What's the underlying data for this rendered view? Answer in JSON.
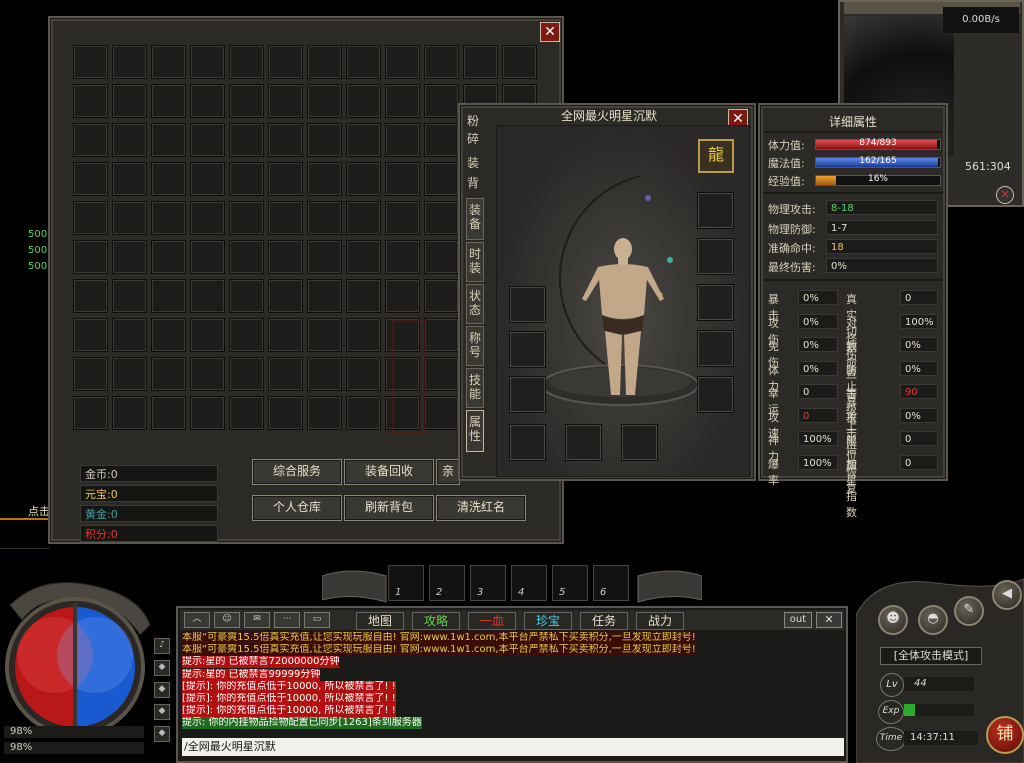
{
  "minimap": {
    "speed": "0.00B/s",
    "coords": "561:304"
  },
  "left_numbers": [
    "500",
    "500",
    "500"
  ],
  "left_partial": "点击",
  "bag": {
    "currency": [
      {
        "label": "金币",
        "value": "0",
        "color": "#e8e0c8"
      },
      {
        "label": "元宝",
        "value": "0",
        "color": "#e6c84a"
      },
      {
        "label": "黄金",
        "value": "0",
        "color": "#3fa0a8"
      },
      {
        "label": "积分",
        "value": "0",
        "color": "#e03a2a"
      }
    ],
    "buttons_row1": [
      "综合服务",
      "装备回收",
      "亲"
    ],
    "buttons_row2": [
      "个人仓库",
      "刷新背包",
      "清洗红名"
    ]
  },
  "character": {
    "title": "全网最火明星沉默",
    "side_tabs_top": [
      "粉",
      "碎",
      "装",
      "背"
    ],
    "tabs": [
      "装备",
      "时装",
      "状态",
      "称号",
      "技能",
      "属性"
    ],
    "emblem": "龍"
  },
  "details": {
    "title": "详细属性",
    "hp_label": "体力值:",
    "hp_text": "874/893",
    "hp_fraction": 0.979,
    "mp_label": "魔法值:",
    "mp_text": "162/165",
    "mp_fraction": 0.982,
    "exp_label": "经验值:",
    "exp_text": "16%",
    "exp_fraction": 0.16,
    "main_stats": [
      {
        "label": "物理攻击:",
        "value": "8-18",
        "color": "#57d957"
      },
      {
        "label": "物理防御:",
        "value": "1-7",
        "color": "#e8e0c8"
      },
      {
        "label": "准确命中:",
        "value": "18",
        "color": "#e6c84a"
      },
      {
        "label": "最终伤害:",
        "value": "0%",
        "color": "#e8e0c8"
      }
    ],
    "grid_stats": [
      {
        "l1": "暴击",
        "v1": "0%",
        "c1": "#e8e0c8",
        "l2": "真实切割",
        "v2": "0",
        "c2": "#e8e0c8"
      },
      {
        "l1": "攻伤",
        "v1": "0%",
        "c1": "#e8e0c8",
        "l2": "对怪伤害",
        "v2": "100%",
        "c2": "#e8e0c8"
      },
      {
        "l1": "免伤",
        "v1": "0%",
        "c1": "#e8e0c8",
        "l2": "致命一击",
        "v2": "0%",
        "c2": "#e8e0c8"
      },
      {
        "l1": "体力",
        "v1": "0%",
        "c1": "#e8e0c8",
        "l2": "防止暴击",
        "v2": "0%",
        "c2": "#e8e0c8"
      },
      {
        "l1": "幸运",
        "v1": "0",
        "c1": "#e8e0c8",
        "l2": "等级上限",
        "v2": "90",
        "c2": "#e03a2a"
      },
      {
        "l1": "攻速",
        "v1": "0",
        "c1": "#e03a2a",
        "l2": "攻击倍数",
        "v2": "0%",
        "c2": "#e8e0c8"
      },
      {
        "l1": "神力",
        "v1": "100%",
        "c1": "#e8e0c8",
        "l2": "单位恢复",
        "v2": "0",
        "c2": "#e8e0c8"
      },
      {
        "l1": "爆率",
        "v1": "100%",
        "c1": "#e8e0c8",
        "l2": "加星指数",
        "v2": "0",
        "c2": "#e8e0c8"
      }
    ]
  },
  "skillbar": [
    "1",
    "2",
    "3",
    "4",
    "5",
    "6"
  ],
  "chat": {
    "tabs": [
      "地图",
      "攻略",
      "一血",
      "珍宝",
      "任务",
      "战力"
    ],
    "tab_colors": [
      "#e8e0c8",
      "#57d957",
      "#e03a2a",
      "#3fd0e0",
      "#e8e0c8",
      "#e8e0c8"
    ],
    "out_label": "out",
    "lines": [
      {
        "text": "本服“可豪爽15.5倍真实充值,让您实现玩服自由! 官网:www.1w1.com,本平台严禁私下买卖积分,一旦发现立即封号!",
        "color": "#e6c84a",
        "bg": "#3a0e08"
      },
      {
        "text": "本服“可豪爽15.5倍真实充值,让您实现玩服自由! 官网:www.1w1.com,本平台严禁私下买卖积分,一旦发现立即封号!",
        "color": "#e6c84a",
        "bg": "#3a0e08"
      },
      {
        "text": "提示:星的 已被禁言72000000分钟",
        "color": "#ffffff",
        "bg": "#b01010"
      },
      {
        "text": "提示:星的 已被禁言99999分钟",
        "color": "#ffffff",
        "bg": "#b01010"
      },
      {
        "text": "[提示]: 你的充值点低于10000, 所以被禁言了! !",
        "color": "#ffffff",
        "bg": "#b01010"
      },
      {
        "text": "[提示]: 你的充值点低于10000, 所以被禁言了! !",
        "color": "#ffffff",
        "bg": "#b01010"
      },
      {
        "text": "[提示]: 你的充值点低于10000, 所以被禁言了! !",
        "color": "#ffffff",
        "bg": "#b01010"
      },
      {
        "text": "提示: 你的内挂物品捡物配置已同步[1263]条到服务器",
        "color": "#ffffff",
        "bg": "#1f6b1f"
      }
    ],
    "input_value": "/全网最火明星沉默"
  },
  "hp_orb": {
    "hp_pct": "98%",
    "mp_pct": "98%"
  },
  "right_panel": {
    "attack_mode": "[全体攻击模式]",
    "lv_label": "Lv",
    "lv_value": "44",
    "exp_label": "Exp",
    "time_label": "Time",
    "time_value": "14:37:11",
    "shop_label": "铺"
  }
}
